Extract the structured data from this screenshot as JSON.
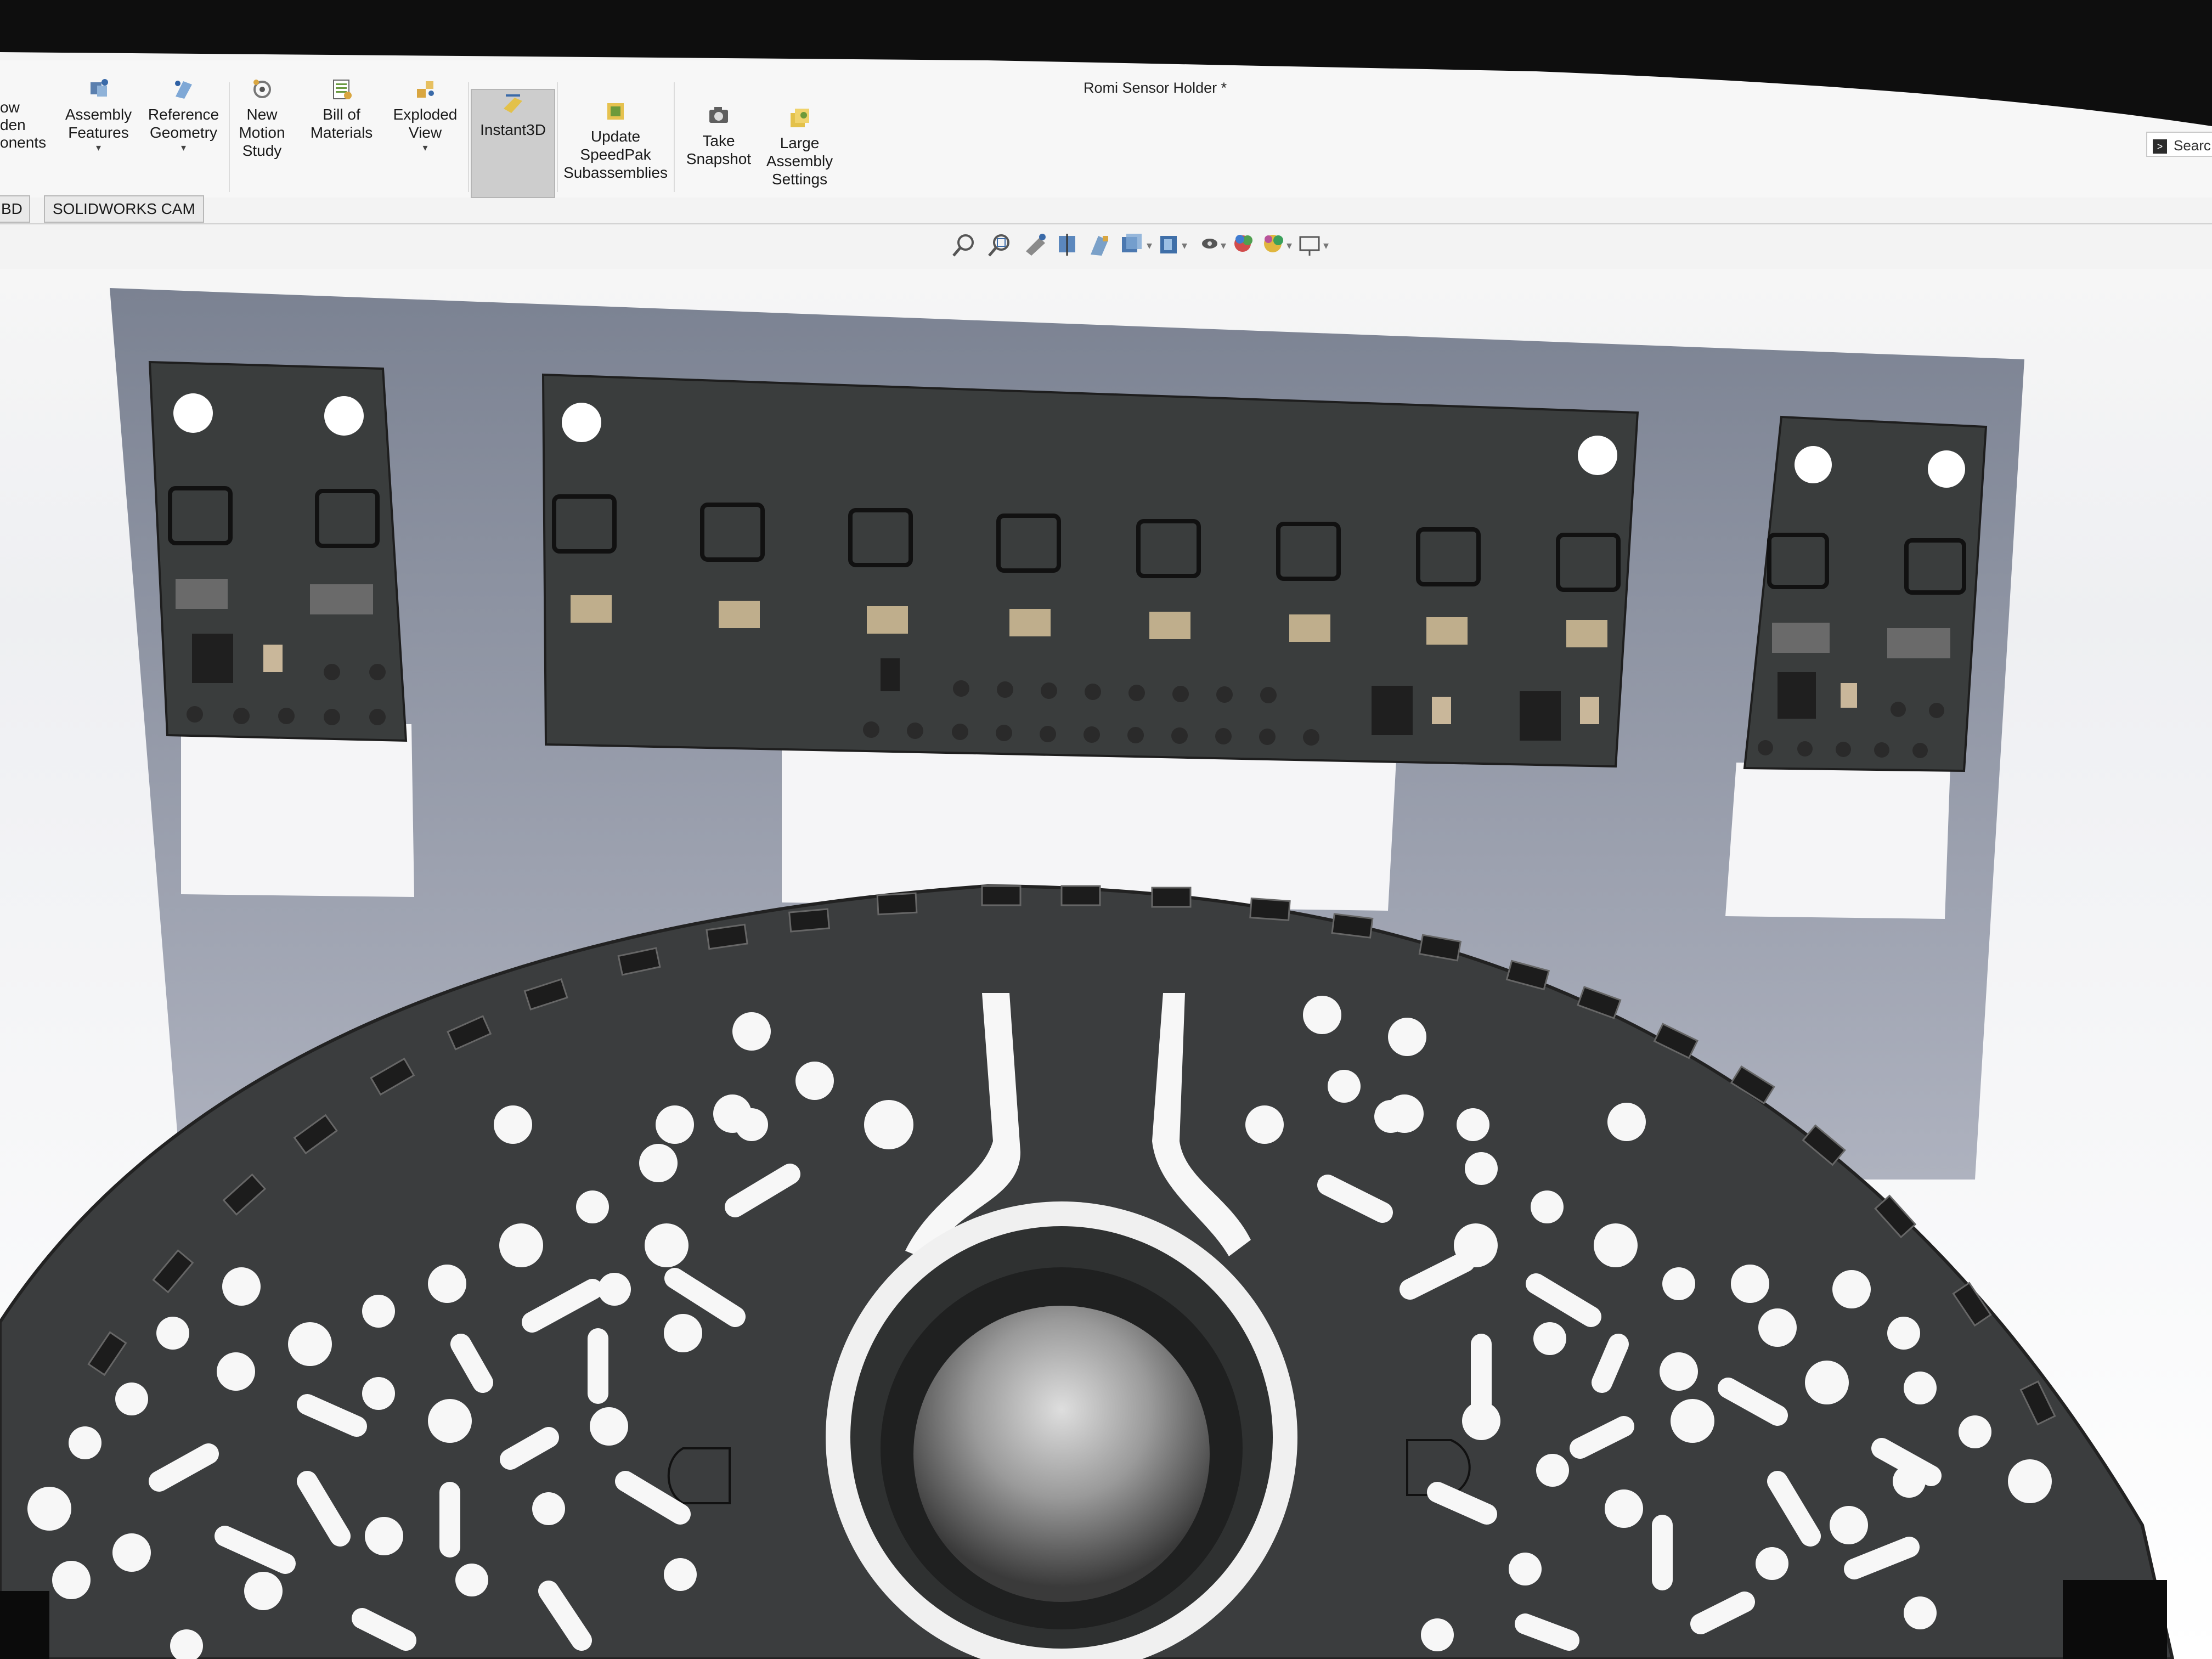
{
  "ribbon": {
    "partial_label": "ow\nden\nonents",
    "buttons": [
      {
        "label": "Assembly\nFeatures",
        "icon": "assembly-features-icon",
        "dropdown": true
      },
      {
        "label": "Reference\nGeometry",
        "icon": "reference-geometry-icon",
        "dropdown": true
      },
      {
        "label": "New\nMotion\nStudy",
        "icon": "motion-study-icon",
        "dropdown": false
      },
      {
        "label": "Bill of\nMaterials",
        "icon": "bill-of-materials-icon",
        "dropdown": false
      },
      {
        "label": "Exploded\nView",
        "icon": "exploded-view-icon",
        "dropdown": true
      },
      {
        "label": "Instant3D",
        "icon": "instant3d-icon",
        "dropdown": false,
        "active": true
      },
      {
        "label": "Update\nSpeedPak\nSubassemblies",
        "icon": "speedpak-icon",
        "dropdown": false
      },
      {
        "label": "Take\nSnapshot",
        "icon": "snapshot-icon",
        "dropdown": false
      },
      {
        "label": "Large\nAssembly\nSettings",
        "icon": "large-assembly-icon",
        "dropdown": false
      }
    ]
  },
  "title": "Romi Sensor Holder *",
  "search": {
    "placeholder": "Searc"
  },
  "tabs": [
    {
      "label": "BD"
    },
    {
      "label": "SOLIDWORKS CAM"
    }
  ],
  "hud_icons": [
    "zoom-to-fit-icon",
    "zoom-area-icon",
    "previous-view-icon",
    "section-view-icon",
    "dynamic-annotation-icon",
    "view-orientation-icon",
    "display-style-icon",
    "hide-show-icon",
    "edit-appearance-icon",
    "apply-scene-icon",
    "view-settings-icon"
  ],
  "colors": {
    "pcb": "#3a3c3c",
    "chassis": "#3b3d3e",
    "viewport_top": "#6d7686",
    "viewport_bottom": "#f4f5f8",
    "holder": "#9ea3b1"
  }
}
